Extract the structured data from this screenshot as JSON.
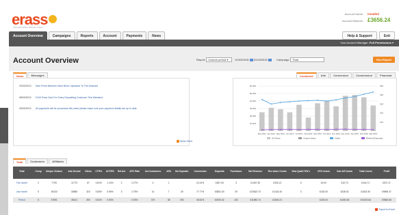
{
  "brand": {
    "name": "erass",
    "tagline": "Scientific Affiliate Efficient Online"
  },
  "account": {
    "name_label": "Account Name:",
    "name_value": "isnadmi",
    "balance_label": "Account Balance:",
    "balance_value": "£3656.24"
  },
  "tabs": [
    "Account Overview",
    "Campaigns",
    "Reports",
    "Account",
    "Payments",
    "News"
  ],
  "header_buttons": [
    "Help & Support",
    "Exit"
  ],
  "user_bar": {
    "text": "Your Account Manager:",
    "value": "Full Permissions"
  },
  "page_title": "Account Overview",
  "filter": {
    "report_label": "Report:",
    "report_value": "Custom period",
    "date_from": "01/03/2015",
    "date_to": "31/03/2015",
    "campaign_label": "Campaign:",
    "campaign_value": "Total",
    "run_label": "Run Report"
  },
  "news": {
    "tabs": [
      "News",
      "Messages"
    ],
    "items": [
      {
        "date": "20/03/2013",
        "text": "New Fresh Banners Have Been Uploaded To The Ashicant"
      },
      {
        "date": "08/03/2013",
        "text": "£100 Extra Cant For Every Depositing Customer This Weekend"
      },
      {
        "date": "05/03/2013",
        "text": "All payments will be processes this week please make sure your payment details are up to date"
      }
    ],
    "feed_label": "News Feed"
  },
  "chart": {
    "tabs": [
      "Combined",
      "Ads",
      "Conversion",
      "Commission",
      "Financial"
    ],
    "icons": {
      "feed": "rss-icon",
      "export": "excel-icon",
      "calendar": "calendar-icon",
      "logo": "bulb-icon"
    },
    "colors": {
      "bar": "#c8c8c8",
      "clicks": "#5aa9e0",
      "deposits": "#9b59d0",
      "accent": "#f08a24",
      "brand": "#e9491f"
    }
  },
  "chart_data": {
    "type": "bar",
    "categories": [
      "Mar 2014",
      "Apr 2014",
      "May 2014",
      "Jun 2014",
      "Jul 2014",
      "Aug 2014",
      "Sep 2014",
      "Oct 2014",
      "Nov 2014",
      "Dec 2014",
      "Jan 2015",
      "Feb 2015",
      "Mar 2015"
    ],
    "ylim": [
      0,
      60000
    ],
    "y_ticks": [
      "10,000",
      "20,000",
      "30,000",
      "40,000",
      "50,000",
      "60,000"
    ],
    "y2_ticks": [
      "100",
      "200",
      "300",
      "400",
      "500"
    ],
    "legend": [
      "Ad Views",
      "Unique Views",
      "Clicks",
      "Referred Deposits"
    ],
    "series": [
      {
        "name": "Ad Views",
        "type": "bar",
        "values": [
          25000,
          31000,
          29000,
          25000,
          35000,
          18000,
          37000,
          40000,
          33000,
          47000,
          48000,
          45000,
          34000
        ]
      },
      {
        "name": "Clicks",
        "type": "line",
        "values": [
          42000,
          36000,
          38000,
          39000,
          40000,
          40500,
          41000,
          40000,
          41500,
          44000,
          46000,
          49000,
          52000
        ]
      },
      {
        "name": "Referred Deposits",
        "type": "line",
        "values": [
          1800,
          2000,
          2100,
          2200,
          2000,
          2300,
          2200,
          2100,
          2400,
          2500,
          2300,
          2200,
          2000
        ]
      }
    ],
    "grid": true,
    "legend_position": "bottom"
  },
  "table": {
    "tabs": [
      "Total",
      "Customers",
      "Affiliates"
    ],
    "headers": [
      "Total",
      "Comp",
      "Unique Visitors",
      "Ads Served",
      "Clicks",
      "CTR%",
      "UCTR%",
      "Ref Act",
      "APC Rate",
      "Act Customers",
      "APA",
      "No Deposits",
      "Conversion",
      "Deposits",
      "Purchases",
      "Net Revenue",
      "Rev share Comm",
      "New Quali CPA's",
      "CPA Comm",
      "Sub Aff Comm",
      "Total Comm",
      "Profit"
    ],
    "rows": [
      [
        "This month",
        "2",
        "7793",
        "11773",
        "67",
        "0.81%",
        "1.13%",
        "2",
        "2.27%",
        "4",
        "1",
        "",
        "24.13%",
        "£287.05",
        "3",
        "£1457.35",
        "£333.13",
        "6",
        "£0.00",
        "£10.70",
        "£344.71",
        "£572.17"
      ],
      [
        "Last month",
        "5",
        "30433",
        "33985",
        "324",
        "0.83%",
        "0.95%",
        "3",
        "2.75%",
        "14",
        "7",
        "29",
        "77.77%",
        "£3801.00",
        "29",
        "£23622.70",
        "£1424.40",
        "3",
        "£153.00",
        "£238.02",
        "£1822.30",
        "£9696.37"
      ],
      [
        "Period",
        "5",
        "37891",
        "45141",
        "392",
        "0.81%",
        "0.93%",
        "",
        "0.93%",
        "370",
        "38",
        "292",
        "45.61%",
        "£2000.02",
        "232",
        "£11982.74",
        "£2040.21",
        "",
        "£225.00",
        "£1083.84",
        "£76220.64",
        "£9653.68"
      ]
    ],
    "export_label": "Export to Excel"
  }
}
